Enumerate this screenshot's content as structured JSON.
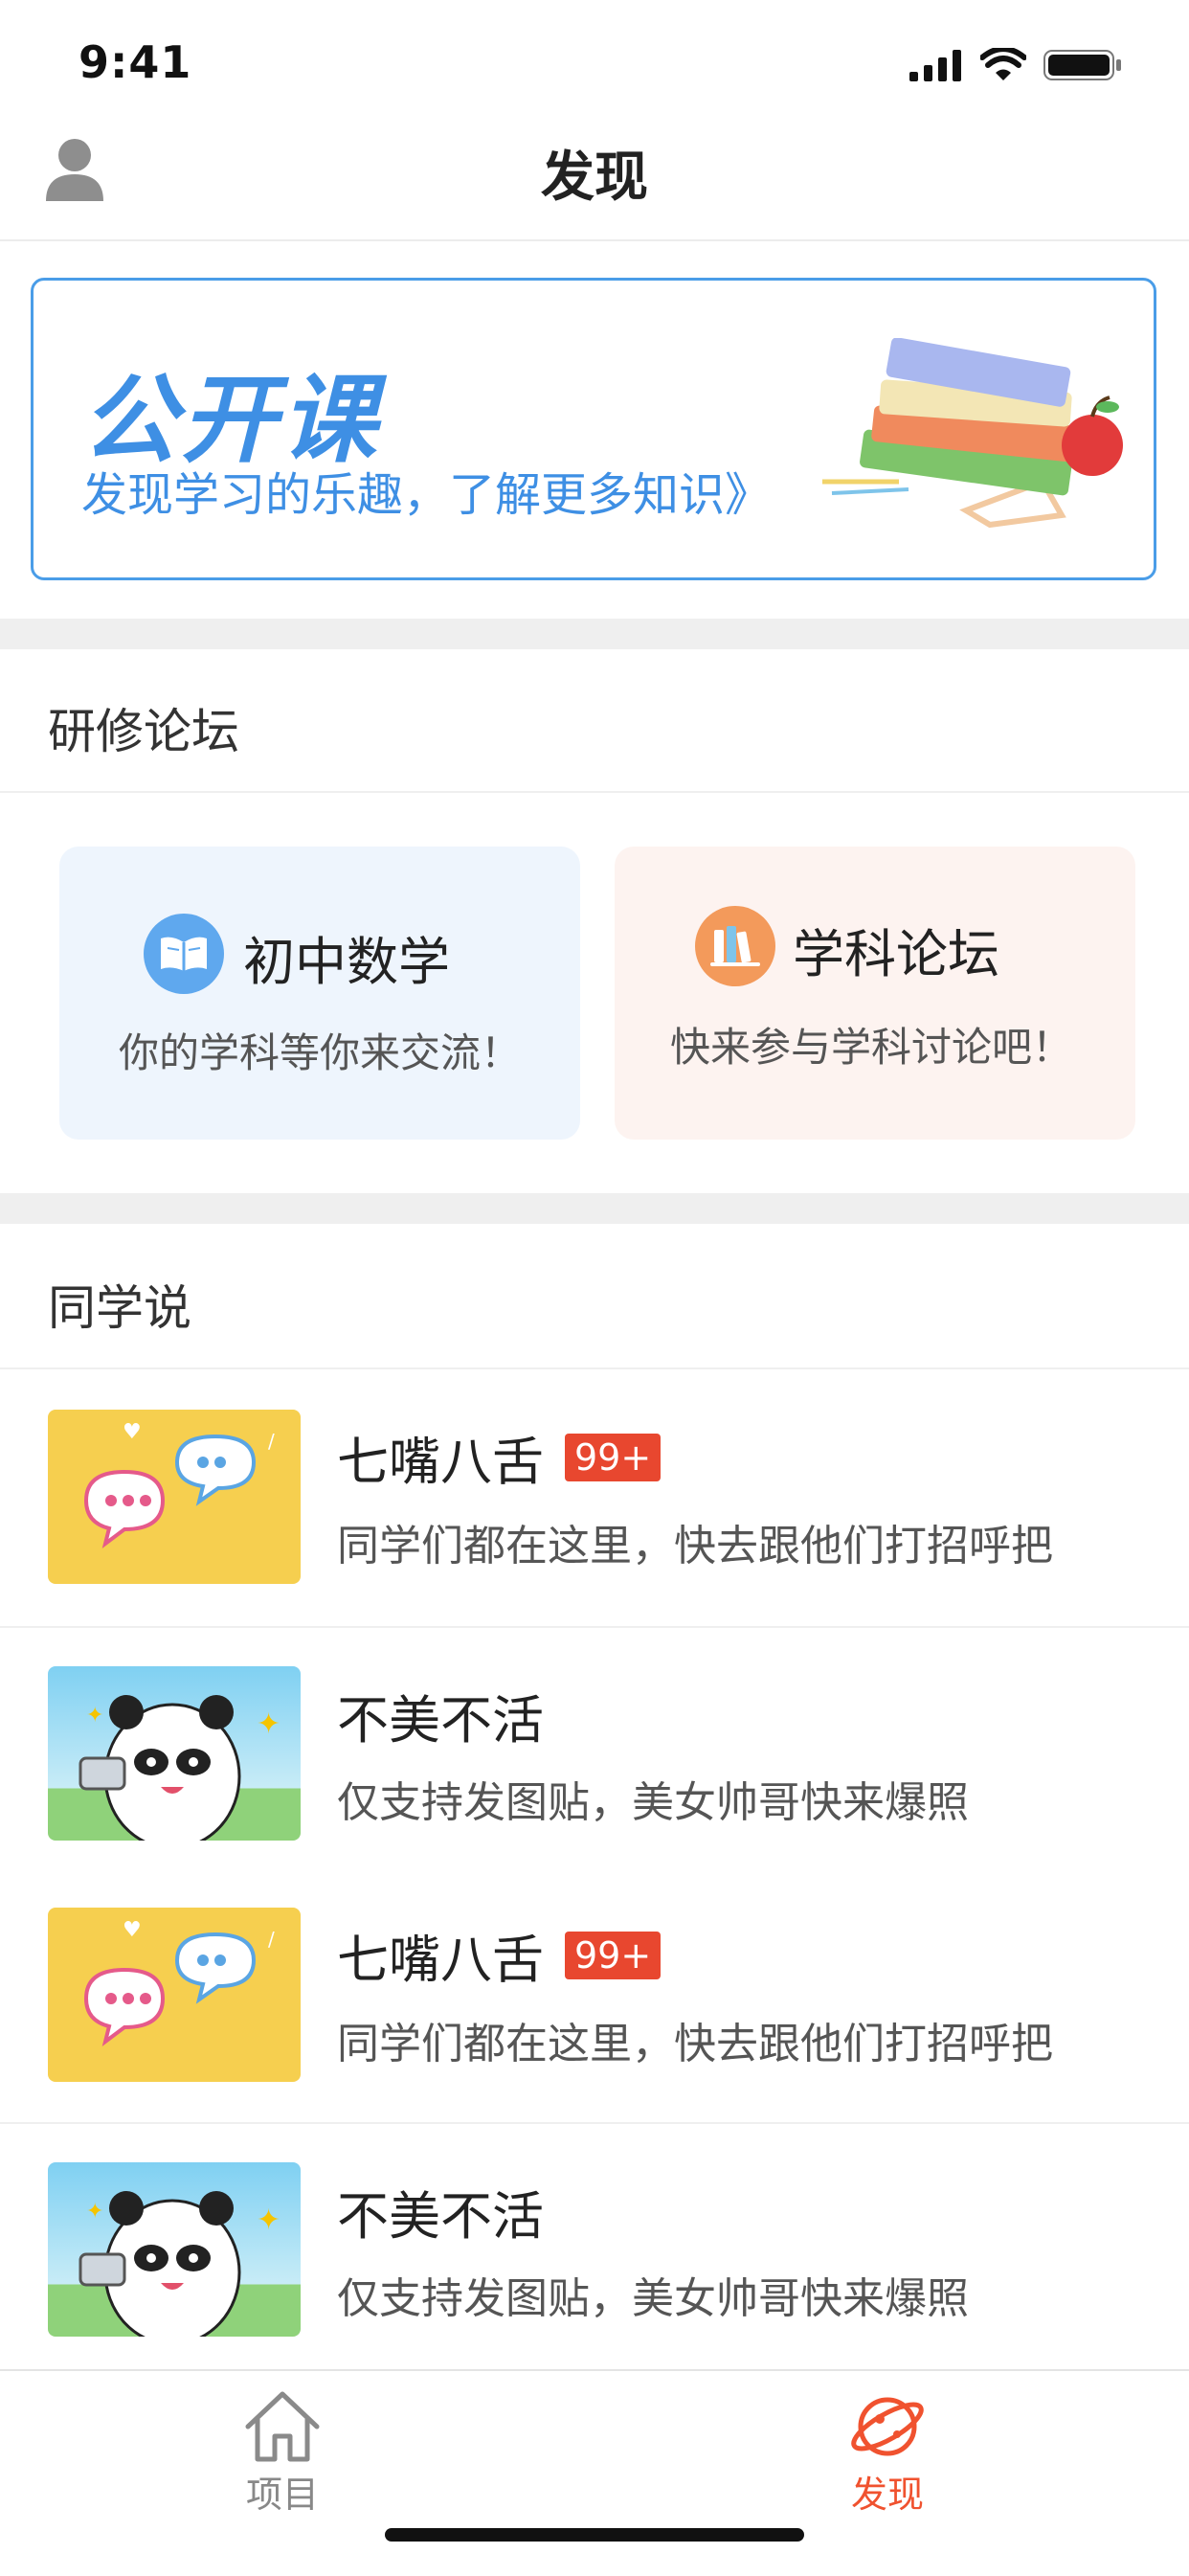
{
  "status_bar": {
    "time": "9:41"
  },
  "nav": {
    "title": "发现",
    "avatar_icon": "user-icon"
  },
  "banner": {
    "title": "公开课",
    "subtitle": "发现学习的乐趣，了解更多知识》",
    "art_icon": "books-and-apple-illustration",
    "accent": "#3e8fe4"
  },
  "forum": {
    "section_title": "研修论坛",
    "cards": [
      {
        "title": "初中数学",
        "desc": "你的学科等你来交流！",
        "icon": "book-icon",
        "bg": "#eef5fd"
      },
      {
        "title": "学科论坛",
        "desc": "快来参与学科讨论吧！",
        "icon": "bookshelf-icon",
        "bg": "#fdf3f0"
      }
    ]
  },
  "classmates": {
    "section_title": "同学说",
    "items": [
      {
        "title": "七嘴八舌",
        "badge": "99+",
        "desc": "同学们都在这里，快去跟他们打招呼把",
        "thumb": "chat-bubbles-thumbnail"
      },
      {
        "title": "不美不活",
        "badge": "",
        "desc": "仅支持发图贴，美女帅哥快来爆照",
        "thumb": "panda-selfie-thumbnail"
      },
      {
        "title": "七嘴八舌",
        "badge": "99+",
        "desc": "同学们都在这里，快去跟他们打招呼把",
        "thumb": "chat-bubbles-thumbnail"
      },
      {
        "title": "不美不活",
        "badge": "",
        "desc": "仅支持发图贴，美女帅哥快来爆照",
        "thumb": "panda-selfie-thumbnail"
      }
    ]
  },
  "tabbar": {
    "tabs": [
      {
        "label": "项目",
        "icon": "home-icon",
        "active": false
      },
      {
        "label": "发现",
        "icon": "planet-icon",
        "active": true
      }
    ],
    "active_color": "#f0522f",
    "inactive_color": "#888888"
  }
}
